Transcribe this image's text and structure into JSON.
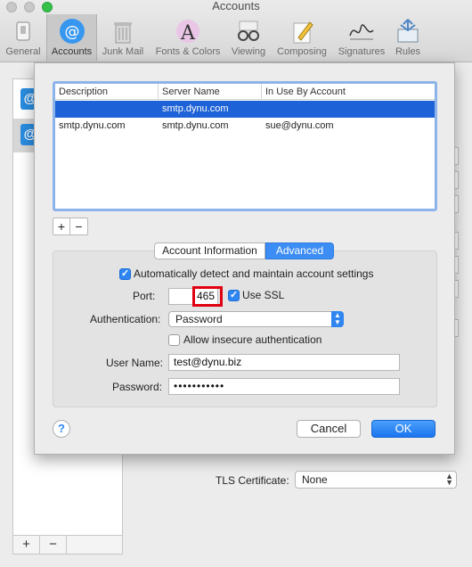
{
  "window": {
    "title": "Accounts"
  },
  "toolbar": {
    "items": [
      {
        "label": "General"
      },
      {
        "label": "Accounts"
      },
      {
        "label": "Junk Mail"
      },
      {
        "label": "Fonts & Colors"
      },
      {
        "label": "Viewing"
      },
      {
        "label": "Composing"
      },
      {
        "label": "Signatures"
      },
      {
        "label": "Rules"
      }
    ],
    "active": "Accounts"
  },
  "account_list": {
    "add_label": "+",
    "remove_label": "−"
  },
  "server_table": {
    "columns": [
      "Description",
      "Server Name",
      "In Use By Account"
    ],
    "rows": [
      {
        "description": "",
        "server": "smtp.dynu.com",
        "account": ""
      },
      {
        "description": "smtp.dynu.com",
        "server": "smtp.dynu.com",
        "account": "sue@dynu.com"
      }
    ],
    "add_label": "+",
    "remove_label": "−"
  },
  "tabs": {
    "account_information": "Account Information",
    "advanced": "Advanced"
  },
  "advanced": {
    "auto_detect_label": "Automatically detect and maintain account settings",
    "port_label": "Port:",
    "port_value": "465",
    "use_ssl_label": "Use SSL",
    "auth_label": "Authentication:",
    "auth_value": "Password",
    "allow_insecure_label": "Allow insecure authentication",
    "username_label": "User Name:",
    "username_value": "test@dynu.biz",
    "password_label": "Password:",
    "password_value": "•••••••••••"
  },
  "buttons": {
    "help": "?",
    "cancel": "Cancel",
    "ok": "OK"
  },
  "behind": {
    "tls_label": "TLS Certificate:",
    "tls_value": "None"
  },
  "colors": {
    "accent": "#2e86f2",
    "selection": "#1d62d6",
    "highlight_box": "#e0000f"
  }
}
